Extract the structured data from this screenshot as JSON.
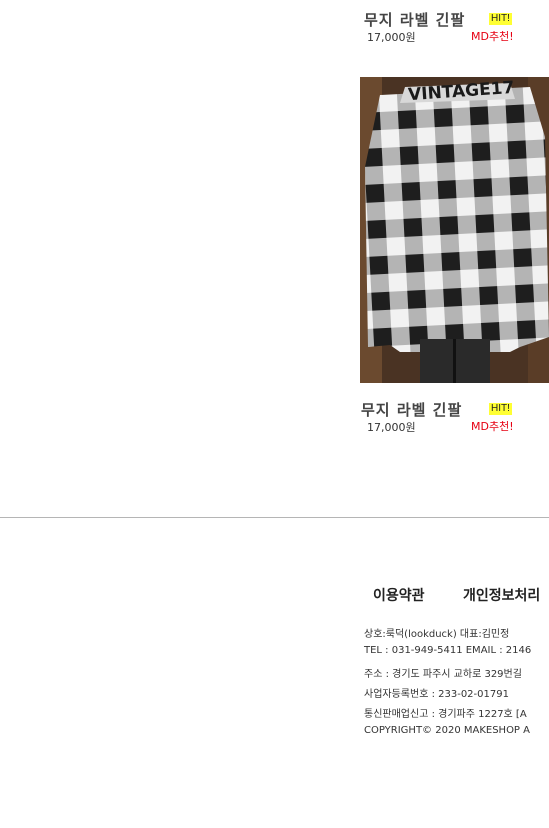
{
  "products": [
    {
      "title": "무지 라벨 긴팔",
      "badge": "HIT!",
      "price": "17,000원",
      "md_pick": "MD추천!"
    },
    {
      "title": "무지 라벨 긴팔",
      "badge": "HIT!",
      "price": "17,000원",
      "md_pick": "MD추천!",
      "image_text": "VINTAGE17"
    }
  ],
  "footer": {
    "links": {
      "terms": "이용약관",
      "privacy": "개인정보처리"
    },
    "company": "상호:룩덕(lookduck)   대표:김민정",
    "contact": "TEL : 031-949-5411    EMAIL : 2146",
    "address": "주소 : 경기도 파주시 교하로 329번길",
    "business_no": "사업자등록번호 : 233-02-01791",
    "ecommerce_no": "통신판매업신고 : 경기파주 1227호 [A",
    "copyright": "COPYRIGHT© 2020 MAKESHOP A"
  }
}
